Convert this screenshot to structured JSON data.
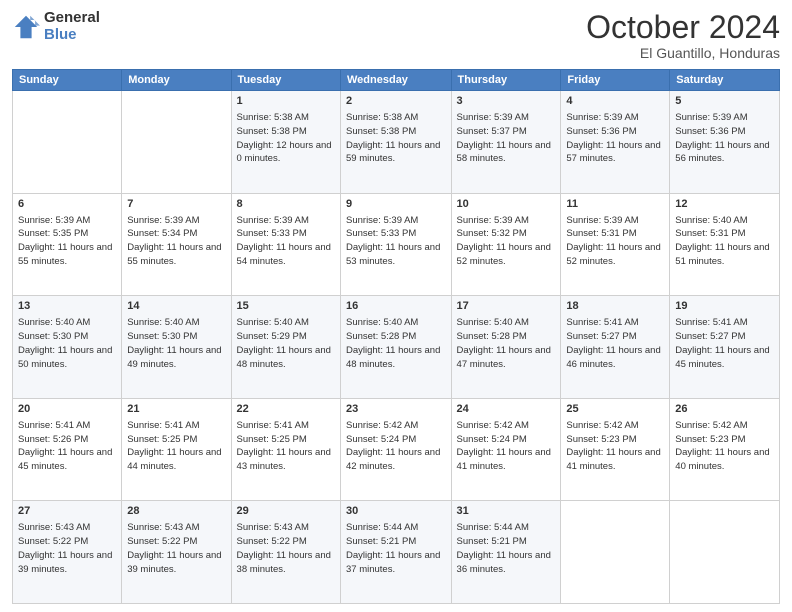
{
  "logo": {
    "general": "General",
    "blue": "Blue"
  },
  "header": {
    "month": "October 2024",
    "location": "El Guantillo, Honduras"
  },
  "weekdays": [
    "Sunday",
    "Monday",
    "Tuesday",
    "Wednesday",
    "Thursday",
    "Friday",
    "Saturday"
  ],
  "weeks": [
    [
      {
        "day": "",
        "sunrise": "",
        "sunset": "",
        "daylight": ""
      },
      {
        "day": "",
        "sunrise": "",
        "sunset": "",
        "daylight": ""
      },
      {
        "day": "1",
        "sunrise": "Sunrise: 5:38 AM",
        "sunset": "Sunset: 5:38 PM",
        "daylight": "Daylight: 12 hours and 0 minutes."
      },
      {
        "day": "2",
        "sunrise": "Sunrise: 5:38 AM",
        "sunset": "Sunset: 5:38 PM",
        "daylight": "Daylight: 11 hours and 59 minutes."
      },
      {
        "day": "3",
        "sunrise": "Sunrise: 5:39 AM",
        "sunset": "Sunset: 5:37 PM",
        "daylight": "Daylight: 11 hours and 58 minutes."
      },
      {
        "day": "4",
        "sunrise": "Sunrise: 5:39 AM",
        "sunset": "Sunset: 5:36 PM",
        "daylight": "Daylight: 11 hours and 57 minutes."
      },
      {
        "day": "5",
        "sunrise": "Sunrise: 5:39 AM",
        "sunset": "Sunset: 5:36 PM",
        "daylight": "Daylight: 11 hours and 56 minutes."
      }
    ],
    [
      {
        "day": "6",
        "sunrise": "Sunrise: 5:39 AM",
        "sunset": "Sunset: 5:35 PM",
        "daylight": "Daylight: 11 hours and 55 minutes."
      },
      {
        "day": "7",
        "sunrise": "Sunrise: 5:39 AM",
        "sunset": "Sunset: 5:34 PM",
        "daylight": "Daylight: 11 hours and 55 minutes."
      },
      {
        "day": "8",
        "sunrise": "Sunrise: 5:39 AM",
        "sunset": "Sunset: 5:33 PM",
        "daylight": "Daylight: 11 hours and 54 minutes."
      },
      {
        "day": "9",
        "sunrise": "Sunrise: 5:39 AM",
        "sunset": "Sunset: 5:33 PM",
        "daylight": "Daylight: 11 hours and 53 minutes."
      },
      {
        "day": "10",
        "sunrise": "Sunrise: 5:39 AM",
        "sunset": "Sunset: 5:32 PM",
        "daylight": "Daylight: 11 hours and 52 minutes."
      },
      {
        "day": "11",
        "sunrise": "Sunrise: 5:39 AM",
        "sunset": "Sunset: 5:31 PM",
        "daylight": "Daylight: 11 hours and 52 minutes."
      },
      {
        "day": "12",
        "sunrise": "Sunrise: 5:40 AM",
        "sunset": "Sunset: 5:31 PM",
        "daylight": "Daylight: 11 hours and 51 minutes."
      }
    ],
    [
      {
        "day": "13",
        "sunrise": "Sunrise: 5:40 AM",
        "sunset": "Sunset: 5:30 PM",
        "daylight": "Daylight: 11 hours and 50 minutes."
      },
      {
        "day": "14",
        "sunrise": "Sunrise: 5:40 AM",
        "sunset": "Sunset: 5:30 PM",
        "daylight": "Daylight: 11 hours and 49 minutes."
      },
      {
        "day": "15",
        "sunrise": "Sunrise: 5:40 AM",
        "sunset": "Sunset: 5:29 PM",
        "daylight": "Daylight: 11 hours and 48 minutes."
      },
      {
        "day": "16",
        "sunrise": "Sunrise: 5:40 AM",
        "sunset": "Sunset: 5:28 PM",
        "daylight": "Daylight: 11 hours and 48 minutes."
      },
      {
        "day": "17",
        "sunrise": "Sunrise: 5:40 AM",
        "sunset": "Sunset: 5:28 PM",
        "daylight": "Daylight: 11 hours and 47 minutes."
      },
      {
        "day": "18",
        "sunrise": "Sunrise: 5:41 AM",
        "sunset": "Sunset: 5:27 PM",
        "daylight": "Daylight: 11 hours and 46 minutes."
      },
      {
        "day": "19",
        "sunrise": "Sunrise: 5:41 AM",
        "sunset": "Sunset: 5:27 PM",
        "daylight": "Daylight: 11 hours and 45 minutes."
      }
    ],
    [
      {
        "day": "20",
        "sunrise": "Sunrise: 5:41 AM",
        "sunset": "Sunset: 5:26 PM",
        "daylight": "Daylight: 11 hours and 45 minutes."
      },
      {
        "day": "21",
        "sunrise": "Sunrise: 5:41 AM",
        "sunset": "Sunset: 5:25 PM",
        "daylight": "Daylight: 11 hours and 44 minutes."
      },
      {
        "day": "22",
        "sunrise": "Sunrise: 5:41 AM",
        "sunset": "Sunset: 5:25 PM",
        "daylight": "Daylight: 11 hours and 43 minutes."
      },
      {
        "day": "23",
        "sunrise": "Sunrise: 5:42 AM",
        "sunset": "Sunset: 5:24 PM",
        "daylight": "Daylight: 11 hours and 42 minutes."
      },
      {
        "day": "24",
        "sunrise": "Sunrise: 5:42 AM",
        "sunset": "Sunset: 5:24 PM",
        "daylight": "Daylight: 11 hours and 41 minutes."
      },
      {
        "day": "25",
        "sunrise": "Sunrise: 5:42 AM",
        "sunset": "Sunset: 5:23 PM",
        "daylight": "Daylight: 11 hours and 41 minutes."
      },
      {
        "day": "26",
        "sunrise": "Sunrise: 5:42 AM",
        "sunset": "Sunset: 5:23 PM",
        "daylight": "Daylight: 11 hours and 40 minutes."
      }
    ],
    [
      {
        "day": "27",
        "sunrise": "Sunrise: 5:43 AM",
        "sunset": "Sunset: 5:22 PM",
        "daylight": "Daylight: 11 hours and 39 minutes."
      },
      {
        "day": "28",
        "sunrise": "Sunrise: 5:43 AM",
        "sunset": "Sunset: 5:22 PM",
        "daylight": "Daylight: 11 hours and 39 minutes."
      },
      {
        "day": "29",
        "sunrise": "Sunrise: 5:43 AM",
        "sunset": "Sunset: 5:22 PM",
        "daylight": "Daylight: 11 hours and 38 minutes."
      },
      {
        "day": "30",
        "sunrise": "Sunrise: 5:44 AM",
        "sunset": "Sunset: 5:21 PM",
        "daylight": "Daylight: 11 hours and 37 minutes."
      },
      {
        "day": "31",
        "sunrise": "Sunrise: 5:44 AM",
        "sunset": "Sunset: 5:21 PM",
        "daylight": "Daylight: 11 hours and 36 minutes."
      },
      {
        "day": "",
        "sunrise": "",
        "sunset": "",
        "daylight": ""
      },
      {
        "day": "",
        "sunrise": "",
        "sunset": "",
        "daylight": ""
      }
    ]
  ]
}
